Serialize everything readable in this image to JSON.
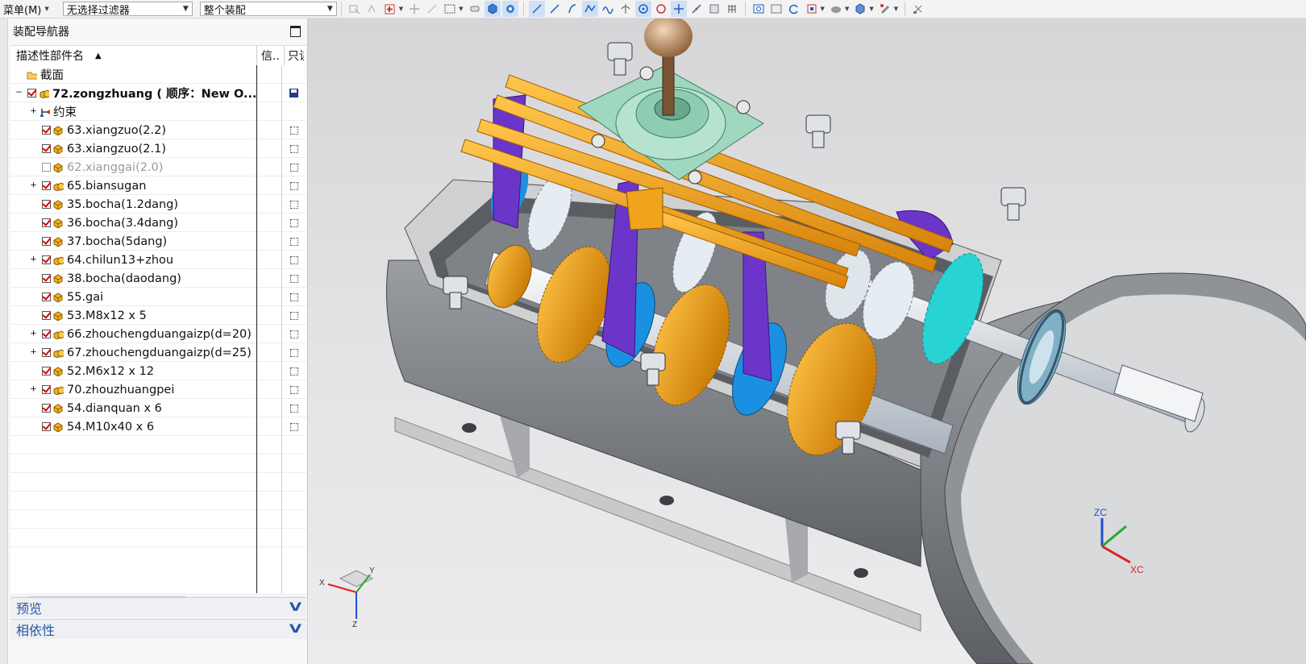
{
  "toolbar": {
    "menu_label": "菜单(M)",
    "filter_value": "无选择过滤器",
    "assembly_value": "整个装配"
  },
  "navigator": {
    "title": "装配导航器",
    "columns": {
      "name": "描述性部件名",
      "info": "信..",
      "readonly": "只读"
    },
    "section_item": "截面",
    "root_item": "72.zongzhuang ( 顺序：New O...",
    "items": [
      {
        "label": "约束",
        "kind": "constraint",
        "expandable": true,
        "checked": null
      },
      {
        "label": "63.xiangzuo(2.2)",
        "kind": "part",
        "expandable": false,
        "checked": true
      },
      {
        "label": "63.xiangzuo(2.1)",
        "kind": "part",
        "expandable": false,
        "checked": true
      },
      {
        "label": "62.xianggai(2.0)",
        "kind": "part",
        "expandable": false,
        "checked": false
      },
      {
        "label": "65.biansugan",
        "kind": "assembly",
        "expandable": true,
        "checked": true
      },
      {
        "label": "35.bocha(1.2dang)",
        "kind": "part",
        "expandable": false,
        "checked": true
      },
      {
        "label": "36.bocha(3.4dang)",
        "kind": "part",
        "expandable": false,
        "checked": true
      },
      {
        "label": "37.bocha(5dang)",
        "kind": "part",
        "expandable": false,
        "checked": true
      },
      {
        "label": "64.chilun13+zhou",
        "kind": "assembly",
        "expandable": true,
        "checked": true
      },
      {
        "label": "38.bocha(daodang)",
        "kind": "part",
        "expandable": false,
        "checked": true
      },
      {
        "label": "55.gai",
        "kind": "part",
        "expandable": false,
        "checked": true
      },
      {
        "label": "53.M8x12 x 5",
        "kind": "part",
        "expandable": false,
        "checked": true
      },
      {
        "label": "66.zhouchengduangaizp(d=20)",
        "kind": "assembly",
        "expandable": true,
        "checked": true
      },
      {
        "label": "67.zhouchengduangaizp(d=25)",
        "kind": "assembly",
        "expandable": true,
        "checked": true
      },
      {
        "label": "52.M6x12 x 12",
        "kind": "part",
        "expandable": false,
        "checked": true
      },
      {
        "label": "70.zhouzhuangpei",
        "kind": "assembly",
        "expandable": true,
        "checked": true
      },
      {
        "label": "54.dianquan x 6",
        "kind": "part",
        "expandable": false,
        "checked": true
      },
      {
        "label": "54.M10x40 x 6",
        "kind": "part",
        "expandable": false,
        "checked": true
      }
    ],
    "preview_label": "预览",
    "dependency_label": "相依性"
  },
  "viewport": {
    "axis_labels": {
      "zc": "ZC",
      "xc": "XC",
      "x": "X",
      "y": "Y",
      "z": "Z"
    },
    "colors": {
      "housing": "#8a8d92",
      "gear_orange": "#f0a31c",
      "fork_purple": "#6a35c8",
      "cyan": "#27d3d3",
      "mint": "#9fd8bf",
      "blue": "#1b90e0"
    }
  }
}
